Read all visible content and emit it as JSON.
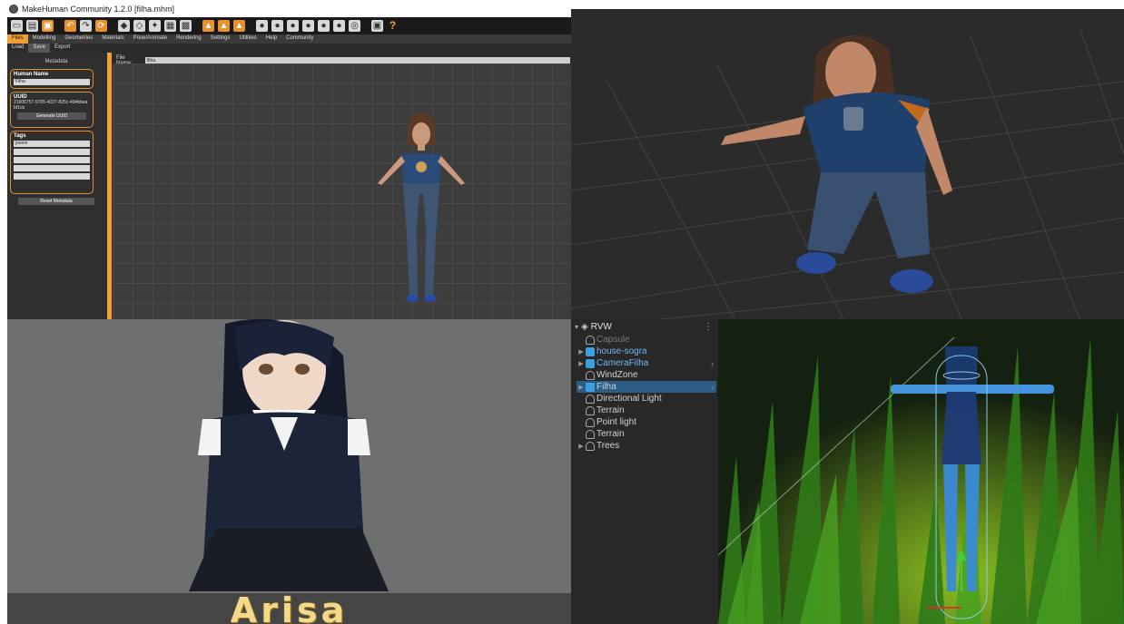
{
  "makehuman": {
    "title": "MakeHuman Community 1.2.0   [filha.mhm]",
    "help_glyph": "?",
    "tabs": [
      "Files",
      "Modelling",
      "Geometries",
      "Materials",
      "Pose/Animate",
      "Rendering",
      "Settings",
      "Utilities",
      "Help",
      "Community"
    ],
    "subtabs": [
      "Load",
      "Save",
      "Export"
    ],
    "left_panel": {
      "heading": "Metadata",
      "name_label": "Human Name",
      "name_value": "Filha",
      "uuid_label": "UUID",
      "uuid_value": "21906757-9705-4037-825c-494bbeabf1cb",
      "generate_button": "Generate UUID",
      "tags_label": "Tags",
      "tag_1": "jovem",
      "reset_button": "Reset Metadata"
    },
    "file_name_label": "File Name:",
    "file_name_value": "filha"
  },
  "anime_preview": {
    "name": "Arisa"
  },
  "unity": {
    "scene_name": "RVW",
    "menu_glyph": "⋮",
    "hierarchy": [
      {
        "label": "Capsule",
        "style": "dim",
        "icon": "gray",
        "arrow": false
      },
      {
        "label": "house-sogra",
        "style": "blue",
        "icon": "blue",
        "arrow": true
      },
      {
        "label": "CameraFilha",
        "style": "blue",
        "icon": "blue",
        "arrow": true,
        "chevron": true
      },
      {
        "label": "WindZone",
        "style": "normal",
        "icon": "gray",
        "arrow": false
      },
      {
        "label": "Filha",
        "style": "normal",
        "icon": "blue",
        "arrow": true,
        "chevron": true,
        "selected": true
      },
      {
        "label": "Directional Light",
        "style": "normal",
        "icon": "gray",
        "arrow": false
      },
      {
        "label": "Terrain",
        "style": "normal",
        "icon": "gray",
        "arrow": false
      },
      {
        "label": "Point light",
        "style": "normal",
        "icon": "gray",
        "arrow": false
      },
      {
        "label": "Terrain",
        "style": "normal",
        "icon": "gray",
        "arrow": false
      },
      {
        "label": "Trees",
        "style": "normal",
        "icon": "gray",
        "arrow": true
      }
    ]
  }
}
